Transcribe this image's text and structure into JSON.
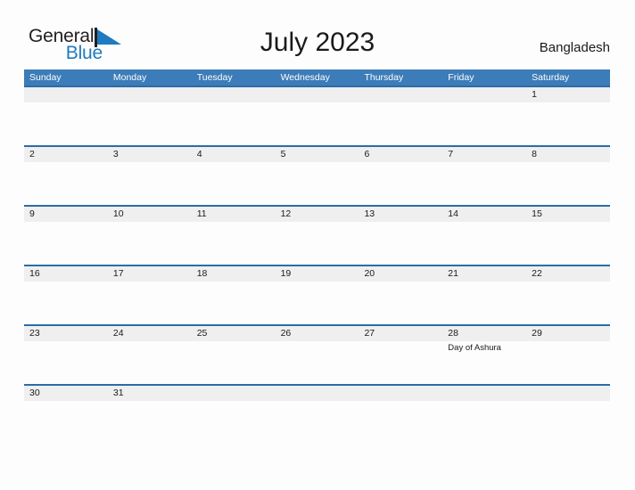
{
  "brand": {
    "word_one": "General",
    "word_two": "Blue",
    "flag_icon": "blue-triangle-flag-icon",
    "color_dark": "#231f20",
    "color_blue": "#1f7ac0"
  },
  "header": {
    "title": "July 2023",
    "country": "Bangladesh"
  },
  "theme": {
    "header_blue": "#3c7cb8",
    "rule_blue": "#2b6ca8",
    "date_band_gray": "#efefef",
    "page_background": "#fdfdfd",
    "text_dark": "#1a1a1a"
  },
  "calendar": {
    "month": "July",
    "year": "2023",
    "weekdays": [
      "Sunday",
      "Monday",
      "Tuesday",
      "Wednesday",
      "Thursday",
      "Friday",
      "Saturday"
    ],
    "weeks": [
      {
        "days": [
          {
            "num": "",
            "event": ""
          },
          {
            "num": "",
            "event": ""
          },
          {
            "num": "",
            "event": ""
          },
          {
            "num": "",
            "event": ""
          },
          {
            "num": "",
            "event": ""
          },
          {
            "num": "",
            "event": ""
          },
          {
            "num": "1",
            "event": ""
          }
        ]
      },
      {
        "days": [
          {
            "num": "2",
            "event": ""
          },
          {
            "num": "3",
            "event": ""
          },
          {
            "num": "4",
            "event": ""
          },
          {
            "num": "5",
            "event": ""
          },
          {
            "num": "6",
            "event": ""
          },
          {
            "num": "7",
            "event": ""
          },
          {
            "num": "8",
            "event": ""
          }
        ]
      },
      {
        "days": [
          {
            "num": "9",
            "event": ""
          },
          {
            "num": "10",
            "event": ""
          },
          {
            "num": "11",
            "event": ""
          },
          {
            "num": "12",
            "event": ""
          },
          {
            "num": "13",
            "event": ""
          },
          {
            "num": "14",
            "event": ""
          },
          {
            "num": "15",
            "event": ""
          }
        ]
      },
      {
        "days": [
          {
            "num": "16",
            "event": ""
          },
          {
            "num": "17",
            "event": ""
          },
          {
            "num": "18",
            "event": ""
          },
          {
            "num": "19",
            "event": ""
          },
          {
            "num": "20",
            "event": ""
          },
          {
            "num": "21",
            "event": ""
          },
          {
            "num": "22",
            "event": ""
          }
        ]
      },
      {
        "days": [
          {
            "num": "23",
            "event": ""
          },
          {
            "num": "24",
            "event": ""
          },
          {
            "num": "25",
            "event": ""
          },
          {
            "num": "26",
            "event": ""
          },
          {
            "num": "27",
            "event": ""
          },
          {
            "num": "28",
            "event": "Day of Ashura"
          },
          {
            "num": "29",
            "event": ""
          }
        ]
      },
      {
        "days": [
          {
            "num": "30",
            "event": ""
          },
          {
            "num": "31",
            "event": ""
          },
          {
            "num": "",
            "event": ""
          },
          {
            "num": "",
            "event": ""
          },
          {
            "num": "",
            "event": ""
          },
          {
            "num": "",
            "event": ""
          },
          {
            "num": "",
            "event": ""
          }
        ]
      }
    ]
  }
}
